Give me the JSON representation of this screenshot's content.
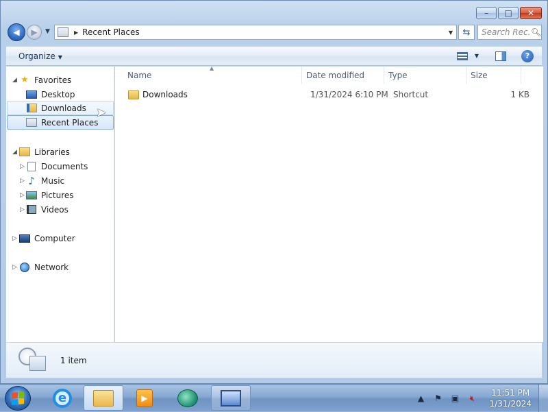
{
  "window": {
    "caption": {
      "minimize": "–",
      "maximize": "□",
      "close": "✕"
    }
  },
  "address": {
    "path": "Recent Places",
    "search_placeholder": "Search Rec..."
  },
  "commandbar": {
    "organize_label": "Organize"
  },
  "navigation": {
    "favorites": {
      "label": "Favorites",
      "items": [
        {
          "label": "Desktop",
          "icon": "desktop-icon"
        },
        {
          "label": "Downloads",
          "icon": "downloads-folder-icon"
        },
        {
          "label": "Recent Places",
          "icon": "recent-places-icon"
        }
      ]
    },
    "libraries": {
      "label": "Libraries",
      "items": [
        {
          "label": "Documents",
          "icon": "documents-icon"
        },
        {
          "label": "Music",
          "icon": "music-icon"
        },
        {
          "label": "Pictures",
          "icon": "pictures-icon"
        },
        {
          "label": "Videos",
          "icon": "videos-icon"
        }
      ]
    },
    "computer": {
      "label": "Computer",
      "icon": "computer-icon"
    },
    "network": {
      "label": "Network",
      "icon": "network-icon"
    }
  },
  "content": {
    "columns": [
      "Name",
      "Date modified",
      "Type",
      "Size"
    ],
    "rows": [
      {
        "name": "Downloads",
        "date_modified": "1/31/2024 6:10 PM",
        "type": "Shortcut",
        "size": "1 KB"
      }
    ]
  },
  "details": {
    "status": "1 item"
  },
  "taskbar": {
    "time": "11:51 PM",
    "date": "1/31/2024",
    "pinned": [
      "internet-explorer-icon",
      "windows-explorer-icon",
      "media-player-icon",
      "app-icon",
      "remote-desktop-icon"
    ]
  },
  "colors": {
    "accent": "#2f6dc4",
    "selection": "#d6e7fb",
    "close_button": "#c33a1b"
  }
}
